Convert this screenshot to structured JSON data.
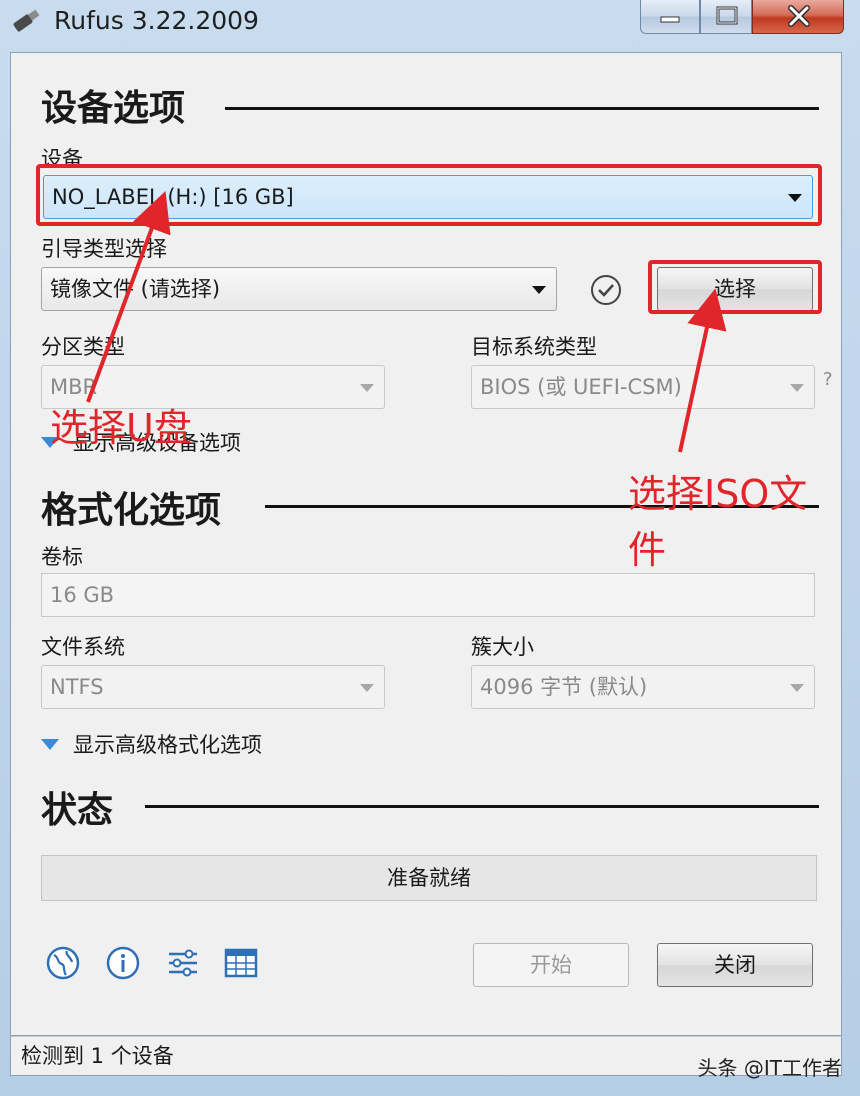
{
  "window": {
    "title": "Rufus 3.22.2009"
  },
  "device_options": {
    "section_title": "设备选项",
    "device_label": "设备",
    "device_value": "NO_LABEL (H:) [16 GB]",
    "boot_label": "引导类型选择",
    "boot_value": "镜像文件 (请选择)",
    "select_button": "选择",
    "partition_label": "分区类型",
    "partition_value": "MBR",
    "target_label": "目标系统类型",
    "target_value": "BIOS (或 UEFI-CSM)",
    "help_mark": "?",
    "advanced_toggle": "显示高级设备选项"
  },
  "format_options": {
    "section_title": "格式化选项",
    "volume_label": "卷标",
    "volume_value": "16 GB",
    "fs_label": "文件系统",
    "fs_value": "NTFS",
    "cluster_label": "簇大小",
    "cluster_value": "4096 字节 (默认)",
    "advanced_toggle": "显示高级格式化选项"
  },
  "status": {
    "section_title": "状态",
    "progress_text": "准备就绪",
    "start_button": "开始",
    "close_button": "关闭"
  },
  "footer": {
    "status_text": "检测到 1 个设备",
    "watermark": "头条 @IT工作者"
  },
  "annotations": {
    "select_usb": "选择U盘",
    "select_iso_line1": "选择ISO文",
    "select_iso_line2": "件",
    "color": "#e0262b"
  },
  "icons": [
    "globe-icon",
    "info-icon",
    "settings-sliders-icon",
    "log-table-icon",
    "check-circle-icon"
  ]
}
